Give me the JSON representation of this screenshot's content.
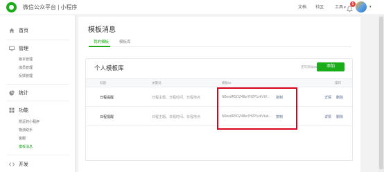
{
  "topbar": {
    "brand": "微信公众平台 | 小程序",
    "links": [
      "文档",
      "社区"
    ],
    "tools_label": "工具",
    "notification_count": "5"
  },
  "sidebar": {
    "home": "首页",
    "manage": {
      "title": "管理",
      "items": [
        "版本管理",
        "成员管理",
        "反馈管理"
      ]
    },
    "stats": "统计",
    "features": {
      "title": "功能",
      "items": [
        "附近的小程序",
        "物流助手",
        "客服",
        "模板消息"
      ]
    },
    "dev": "开发"
  },
  "main": {
    "title": "模板消息",
    "tabs": [
      "我的模板",
      "模板库"
    ],
    "card": {
      "title": "个人模板库",
      "note": "还可添加25个",
      "add_label": "添加",
      "columns": [
        "标题",
        "关键词",
        "模板ID",
        "操作"
      ],
      "rows": [
        {
          "title": "日程提醒",
          "keywords": "日程主题、日程时间、日程地点",
          "template_id": "N0esdR5OZ48w7H2P1vkVtV...",
          "copy": "复制",
          "detail": "详情",
          "delete": "删除"
        },
        {
          "title": "日程提醒",
          "keywords": "日程主题、日程时间、日程地点",
          "template_id": "N0esdR5OZ48w7H2P1vkVtu4...",
          "copy": "复制",
          "detail": "详情",
          "delete": "删除"
        }
      ]
    }
  }
}
